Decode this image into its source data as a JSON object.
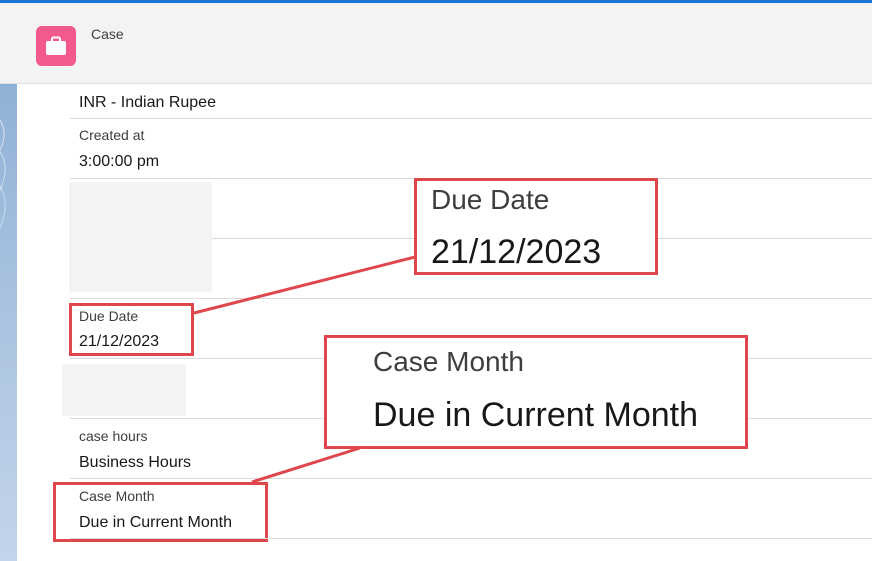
{
  "header": {
    "title": "Case",
    "icon": "briefcase-icon",
    "icon_color": "#f2598c"
  },
  "fields": {
    "currency_value": "INR - Indian Rupee",
    "created_at_label": "Created at",
    "created_at_value": "3:00:00 pm",
    "due_date_label": "Due Date",
    "due_date_value": "21/12/2023",
    "case_hours_label": "case hours",
    "case_hours_value": "Business Hours",
    "case_month_label": "Case Month",
    "case_month_value": "Due in Current Month"
  },
  "callouts": {
    "due_date": {
      "label": "Due Date",
      "value": "21/12/2023"
    },
    "case_month": {
      "label": "Case Month",
      "value": "Due in Current Month"
    }
  },
  "colors": {
    "highlight": "#e0474c",
    "top_accent": "#1b74d1"
  }
}
